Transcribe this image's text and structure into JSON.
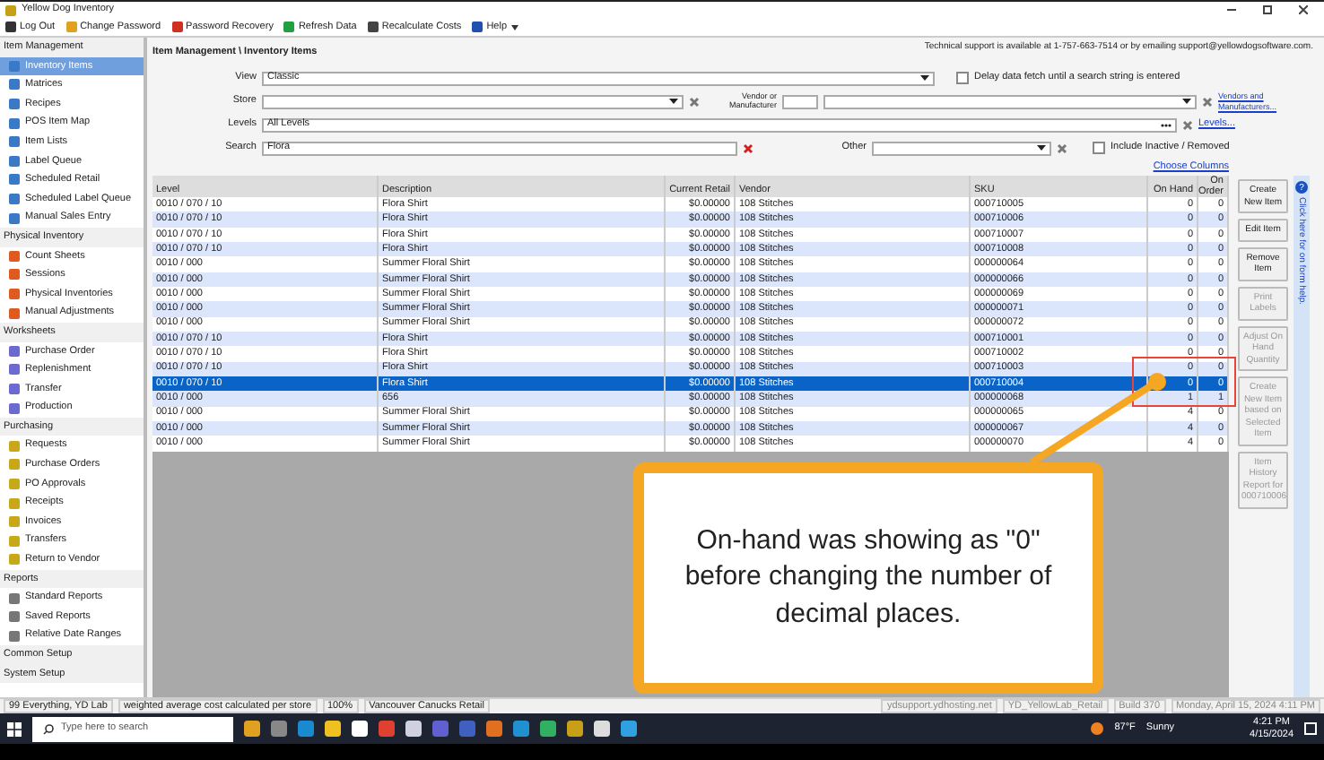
{
  "window": {
    "title": "Yellow Dog Inventory"
  },
  "toolbar": [
    "Log Out",
    "Change Password",
    "Password Recovery",
    "Refresh Data",
    "Recalculate Costs",
    "Help"
  ],
  "support_text": "Technical support is available at 1-757-663-7514 or by emailing support@yellowdogsoftware.com.",
  "sidebar": [
    {
      "label": "Item Management",
      "items": [
        {
          "label": "Inventory Items",
          "selected": true
        },
        {
          "label": "Matrices",
          "selected": false
        },
        {
          "label": "Recipes",
          "selected": false
        },
        {
          "label": "POS Item Map",
          "selected": false
        },
        {
          "label": "Item Lists",
          "selected": false
        },
        {
          "label": "Label Queue",
          "selected": false
        },
        {
          "label": "Scheduled Retail",
          "selected": false
        },
        {
          "label": "Scheduled Label Queue",
          "selected": false
        },
        {
          "label": "Manual Sales Entry",
          "selected": false
        }
      ]
    },
    {
      "label": "Physical Inventory",
      "items": [
        {
          "label": "Count Sheets",
          "selected": false
        },
        {
          "label": "Sessions",
          "selected": false
        },
        {
          "label": "Physical Inventories",
          "selected": false
        },
        {
          "label": "Manual Adjustments",
          "selected": false
        }
      ]
    },
    {
      "label": "Worksheets",
      "items": [
        {
          "label": "Purchase Order",
          "selected": false
        },
        {
          "label": "Replenishment",
          "selected": false
        },
        {
          "label": "Transfer",
          "selected": false
        },
        {
          "label": "Production",
          "selected": false
        }
      ]
    },
    {
      "label": "Purchasing",
      "items": [
        {
          "label": "Requests",
          "selected": false
        },
        {
          "label": "Purchase Orders",
          "selected": false
        },
        {
          "label": "PO Approvals",
          "selected": false
        },
        {
          "label": "Receipts",
          "selected": false
        },
        {
          "label": "Invoices",
          "selected": false
        },
        {
          "label": "Transfers",
          "selected": false
        },
        {
          "label": "Return to Vendor",
          "selected": false
        }
      ]
    },
    {
      "label": "Reports",
      "items": [
        {
          "label": "Standard Reports",
          "selected": false
        },
        {
          "label": "Saved Reports",
          "selected": false
        },
        {
          "label": "Relative Date Ranges",
          "selected": false
        }
      ]
    },
    {
      "label": "Common Setup"
    },
    {
      "label": "System Setup"
    }
  ],
  "breadcrumb": "Item Management \\ Inventory Items",
  "filters": {
    "view": {
      "label": "View",
      "value": "Classic"
    },
    "store": {
      "label": "Store"
    },
    "levels": {
      "label": "Levels",
      "value": "All Levels"
    },
    "search": {
      "label": "Search",
      "value": "Flora"
    },
    "delay": {
      "label": "Delay data fetch until a search string is entered",
      "checked": false
    },
    "vendor": {
      "label": "Vendor or Manufacturer",
      "link": "Vendors and Manufacturers..."
    },
    "levels_link": "Levels...",
    "other": {
      "label": "Other"
    },
    "inactive": {
      "label": "Include Inactive / Removed",
      "checked": false
    }
  },
  "choose_columns": "Choose Columns",
  "table": {
    "columns": [
      "Level",
      "Description",
      "Current Retail",
      "Vendor",
      "SKU",
      "On Hand",
      "On Order"
    ],
    "rows": [
      {
        "cells": [
          "0010 / 070 / 10",
          "Flora Shirt",
          "$0.00000",
          "108 Stitches",
          "000710005",
          "0",
          "0"
        ],
        "selected": false
      },
      {
        "cells": [
          "0010 / 070 / 10",
          "Flora Shirt",
          "$0.00000",
          "108 Stitches",
          "000710006",
          "0",
          "0"
        ],
        "selected": false
      },
      {
        "cells": [
          "0010 / 070 / 10",
          "Flora Shirt",
          "$0.00000",
          "108 Stitches",
          "000710007",
          "0",
          "0"
        ],
        "selected": false
      },
      {
        "cells": [
          "0010 / 070 / 10",
          "Flora Shirt",
          "$0.00000",
          "108 Stitches",
          "000710008",
          "0",
          "0"
        ],
        "selected": false
      },
      {
        "cells": [
          "0010 / 000",
          "Summer Floral Shirt",
          "$0.00000",
          "108 Stitches",
          "000000064",
          "0",
          "0"
        ],
        "selected": false
      },
      {
        "cells": [
          "0010 / 000",
          "Summer Floral Shirt",
          "$0.00000",
          "108 Stitches",
          "000000066",
          "0",
          "0"
        ],
        "selected": false
      },
      {
        "cells": [
          "0010 / 000",
          "Summer Floral Shirt",
          "$0.00000",
          "108 Stitches",
          "000000069",
          "0",
          "0"
        ],
        "selected": false
      },
      {
        "cells": [
          "0010 / 000",
          "Summer Floral Shirt",
          "$0.00000",
          "108 Stitches",
          "000000071",
          "0",
          "0"
        ],
        "selected": false
      },
      {
        "cells": [
          "0010 / 000",
          "Summer Floral Shirt",
          "$0.00000",
          "108 Stitches",
          "000000072",
          "0",
          "0"
        ],
        "selected": false
      },
      {
        "cells": [
          "0010 / 070 / 10",
          "Flora Shirt",
          "$0.00000",
          "108 Stitches",
          "000710001",
          "0",
          "0"
        ],
        "selected": false
      },
      {
        "cells": [
          "0010 / 070 / 10",
          "Flora Shirt",
          "$0.00000",
          "108 Stitches",
          "000710002",
          "0",
          "0"
        ],
        "selected": false
      },
      {
        "cells": [
          "0010 / 070 / 10",
          "Flora Shirt",
          "$0.00000",
          "108 Stitches",
          "000710003",
          "0",
          "0"
        ],
        "selected": false
      },
      {
        "cells": [
          "0010 / 070 / 10",
          "Flora Shirt",
          "$0.00000",
          "108 Stitches",
          "000710004",
          "0",
          "0"
        ],
        "selected": true
      },
      {
        "cells": [
          "0010 / 000",
          "656",
          "$0.00000",
          "108 Stitches",
          "000000068",
          "1",
          "1"
        ],
        "selected": false
      },
      {
        "cells": [
          "0010 / 000",
          "Summer Floral Shirt",
          "$0.00000",
          "108 Stitches",
          "000000065",
          "4",
          "0"
        ],
        "selected": false
      },
      {
        "cells": [
          "0010 / 000",
          "Summer Floral Shirt",
          "$0.00000",
          "108 Stitches",
          "000000067",
          "4",
          "0"
        ],
        "selected": false
      },
      {
        "cells": [
          "0010 / 000",
          "Summer Floral Shirt",
          "$0.00000",
          "108 Stitches",
          "000000070",
          "4",
          "0"
        ],
        "selected": false
      }
    ]
  },
  "buttons": [
    {
      "label": "Create New Item",
      "disabled": false
    },
    {
      "label": "Edit Item",
      "disabled": false
    },
    {
      "label": "Remove Item",
      "disabled": false
    },
    {
      "label": "Print Labels",
      "disabled": true
    },
    {
      "label": "Adjust On Hand Quantity",
      "disabled": true
    },
    {
      "label": "Create New Item based on Selected Item",
      "disabled": true
    },
    {
      "label": "Item History Report for 000710006",
      "disabled": true
    }
  ],
  "help_icon": "?",
  "help_tab": "Click here for on form help.",
  "callout": "On-hand was showing as \"0\" before changing the number of decimal places.",
  "status_bar": [
    "99 Everything, YD Lab",
    "weighted average cost calculated per store",
    "100%",
    "Vancouver Canucks Retail",
    "ydsupport.ydhosting.net",
    "YD_YellowLab_Retail",
    "Build 370",
    "Monday, April 15, 2024 4:11 PM"
  ],
  "taskbar": {
    "search_placeholder": "Type here to search",
    "weather": "87°F",
    "weather_text": "Sunny",
    "time": "4:21 PM",
    "date": "4/15/2024"
  }
}
